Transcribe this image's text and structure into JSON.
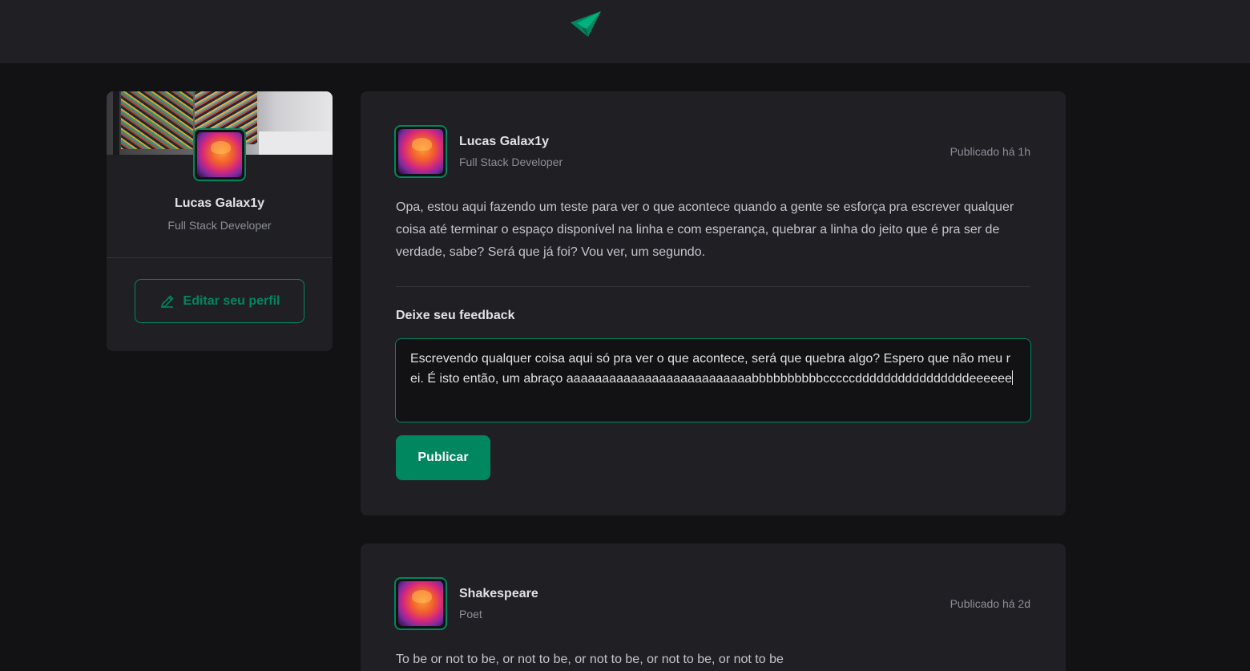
{
  "header": {
    "logo_icon": "ignite-feed-logo-icon"
  },
  "sidebar": {
    "cover_image": "workspace-cover-image",
    "avatar": "avatar-image",
    "name": "Lucas Galax1y",
    "role": "Full Stack Developer",
    "edit_icon": "pencil-icon",
    "edit_label": "Editar seu perfil"
  },
  "posts": [
    {
      "author": "Lucas Galax1y",
      "role": "Full Stack Developer",
      "published": "Publicado há 1h",
      "content": "Opa, estou aqui fazendo um teste para ver o que acontece quando a gente se esforça pra escrever qualquer coisa até terminar o espaço disponível na linha e com esperança, quebrar a linha do jeito que é pra ser de verdade, sabe? Será que já foi? Vou ver, um segundo.",
      "feedback_title": "Deixe seu feedback",
      "feedback_value": "Escrevendo qualquer coisa aqui só pra ver o que acontece, será que quebra algo? Espero que não meu rei. É isto então, um abraço aaaaaaaaaaaaaaaaaaaaaaaaaabbbbbbbbbbcccccddddddddddddddddeeeeee",
      "publish_label": "Publicar"
    },
    {
      "author": "Shakespeare",
      "role": "Poet",
      "published": "Publicado há 2d",
      "content": "To be or not to be, or not to be, or not to be, or not to be, or not to be"
    }
  ],
  "colors": {
    "accent": "#00875f",
    "background": "#121214",
    "surface": "#202024",
    "divider": "#323238"
  }
}
